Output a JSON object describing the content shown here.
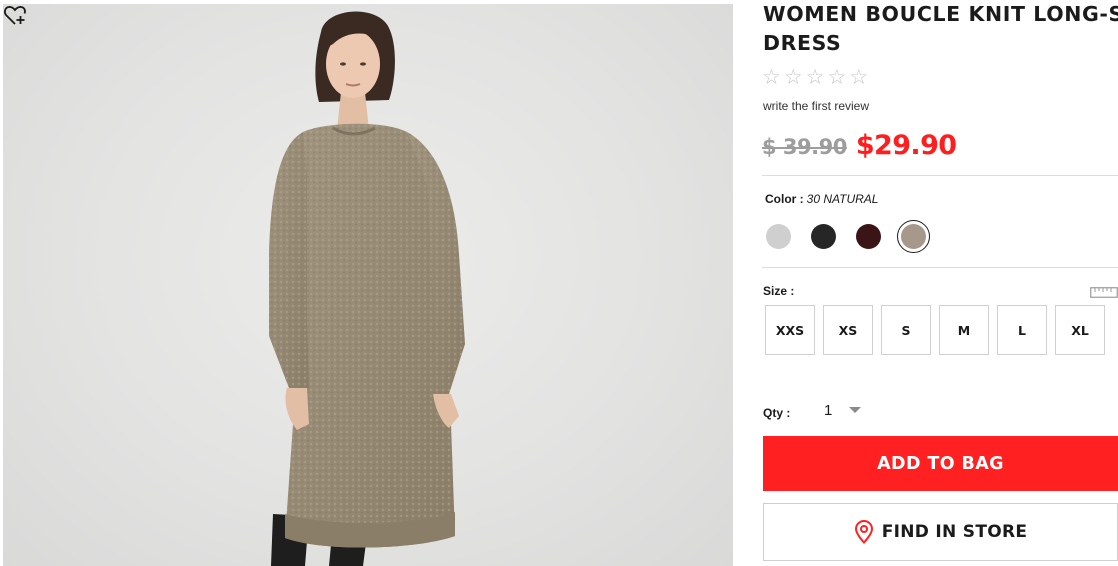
{
  "product": {
    "title_line1": "WOMEN BOUCLE KNIT LONG-SLEEVE",
    "title_line2": "DRESS",
    "review_link": "write the first review",
    "rating": {
      "value": 0,
      "max": 5
    },
    "price_original": "$ 39.90",
    "price_sale": "$29.90"
  },
  "color": {
    "label": "Color :",
    "selected_name": "30 NATURAL",
    "swatches": [
      {
        "color": "#cfcfcf",
        "selected": false
      },
      {
        "color": "#262626",
        "selected": false
      },
      {
        "color": "#3a1416",
        "selected": false
      },
      {
        "color": "#a6988a",
        "selected": true
      }
    ]
  },
  "size": {
    "label": "Size :",
    "options": [
      "XXS",
      "XS",
      "S",
      "M",
      "L",
      "XL"
    ],
    "size_guide_icon": "ruler-icon"
  },
  "quantity": {
    "label": "Qty :",
    "value": "1"
  },
  "actions": {
    "add_to_bag": "ADD TO BAG",
    "find_in_store": "FIND IN STORE",
    "find_in_store_icon": "location-pin-icon"
  },
  "image": {
    "wishlist_icon": "heart-plus-icon"
  },
  "colors": {
    "accent_red": "#ff2121",
    "sale_price": "#ff1e1e",
    "strike_price": "#9d9d9d"
  }
}
